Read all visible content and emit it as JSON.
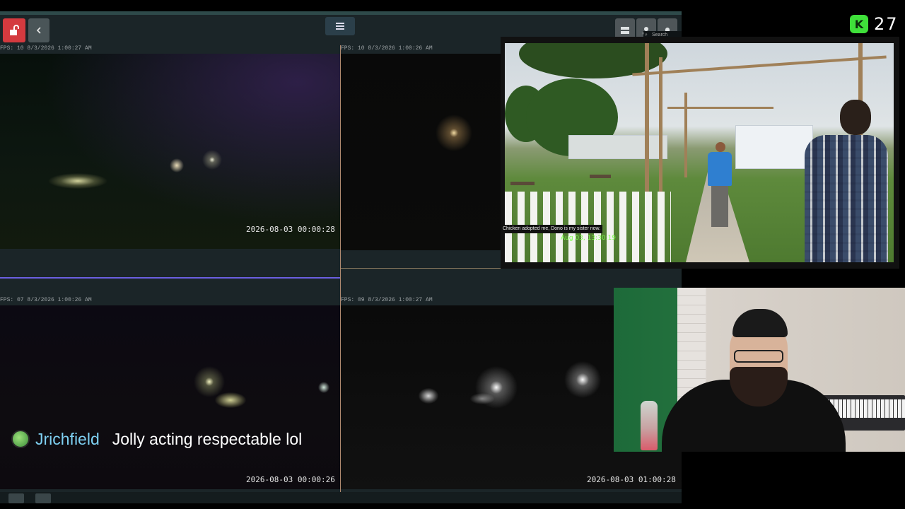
{
  "counter": {
    "value": "27",
    "icon": "kick-logo-icon",
    "icon_letter": "K",
    "accent": "#3fe03a"
  },
  "nvr": {
    "search": {
      "placeholder": "Search"
    },
    "toolbar": {
      "lock_icon": "unlock-icon",
      "back_icon": "chevron-left-icon",
      "menu_icon": "hamburger-menu-icon"
    },
    "cameras": [
      {
        "fps": "FPS: 10 8/3/2026 1:00:27 AM",
        "timestamp": "2026-08-03  00:00:28"
      },
      {
        "fps": "FPS: 10 8/3/2026 1:00:26 AM",
        "timestamp": ""
      },
      {
        "fps": "FPS: 07 8/3/2026 1:00:26 AM",
        "timestamp": "2026-08-03  00:00:26"
      },
      {
        "fps": "FPS: 09 8/3/2026 1:00:27 AM",
        "timestamp": "2026-08-03  01:00:28"
      }
    ],
    "colors": {
      "lock_button": "#d43a3f",
      "active_border": "#6b5fe0"
    }
  },
  "irl_stream": {
    "caption": "Chicken adopted me, Dono is my sister now.",
    "date": "Aug 03, 13:30:19",
    "date_color": "#7bff48"
  },
  "chat": {
    "username": "Jrichfield",
    "message": "Jolly acting respectable lol",
    "username_color": "#7ed0f2"
  }
}
